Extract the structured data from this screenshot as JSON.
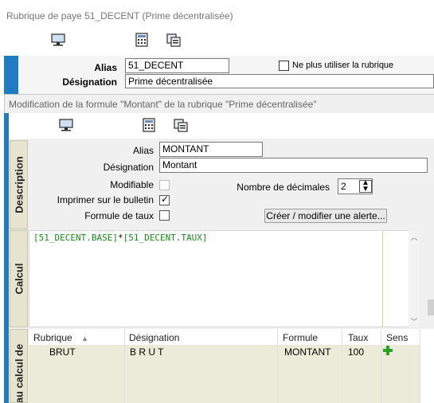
{
  "window": {
    "title": "Rubrique de paye 51_DECENT (Prime décentralisée)"
  },
  "outer_form": {
    "alias_label": "Alias",
    "alias_value": "51_DECENT",
    "designation_label": "Désignation",
    "designation_value": "Prime décentralisée",
    "no_longer_use_label": "Ne plus utiliser la rubrique"
  },
  "dialog": {
    "title": "Modification de la formule \"Montant\" de la rubrique \"Prime décentralisée\"",
    "tabs": {
      "description": "Description",
      "calcul": "Calcul",
      "bottom": "au calcul de"
    },
    "description": {
      "alias_label": "Alias",
      "alias_value": "MONTANT",
      "designation_label": "Désignation",
      "designation_value": "Montant",
      "modifiable_label": "Modifiable",
      "print_label": "Imprimer sur le bulletin",
      "rate_formula_label": "Formule de taux",
      "decimals_label": "Nombre de décimales",
      "decimals_value": "2",
      "alert_button": "Créer / modifier une alerte..."
    },
    "calcul": {
      "part1": "[51_DECENT.BASE]",
      "operator": "*",
      "part2": "[51_DECENT.TAUX]"
    },
    "grid": {
      "columns": [
        "Rubrique",
        "Désignation",
        "Formule",
        "Taux",
        "Sens"
      ],
      "rows": [
        {
          "rubrique": "BRUT",
          "designation": "B R U T",
          "formule": "MONTANT",
          "taux": "100",
          "sens_icon": "plus-icon"
        }
      ]
    }
  },
  "colors": {
    "accent_blue": "#1f7bc2",
    "formula_green": "#1a8a1a",
    "side_panel": "#e6e4cf",
    "plus_green": "#2aa12a"
  }
}
